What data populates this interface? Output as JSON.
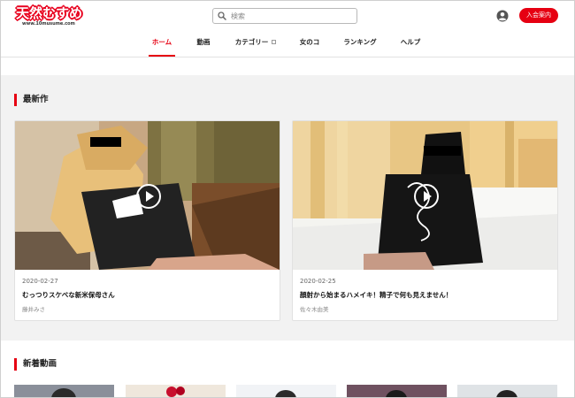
{
  "header": {
    "logo_text": "天然むすめ",
    "logo_sub": "www.10musume.com",
    "search_placeholder": "検索",
    "search_icon": "search-icon",
    "user_icon": "user-circle-icon",
    "join_label": "入会案内",
    "brand_color": "#e60012"
  },
  "nav": {
    "items": [
      {
        "label": "ホーム",
        "active": true
      },
      {
        "label": "動画",
        "active": false
      },
      {
        "label": "カテゴリー",
        "active": false,
        "has_dropdown": true
      },
      {
        "label": "女のコ",
        "active": false
      },
      {
        "label": "ランキング",
        "active": false
      },
      {
        "label": "ヘルプ",
        "active": false
      }
    ]
  },
  "latest": {
    "title": "最新作",
    "cards": [
      {
        "date": "2020-02-27",
        "title": "むっつりスケベな新米保母さん",
        "actress": "藤井みさ",
        "icon": "play-icon"
      },
      {
        "date": "2020-02-25",
        "title": "顔射から始まるハメイキ！精子で何も見えません！",
        "actress": "佐々木由美",
        "icon": "play-icon"
      }
    ]
  },
  "new_videos": {
    "title": "新着動画"
  }
}
